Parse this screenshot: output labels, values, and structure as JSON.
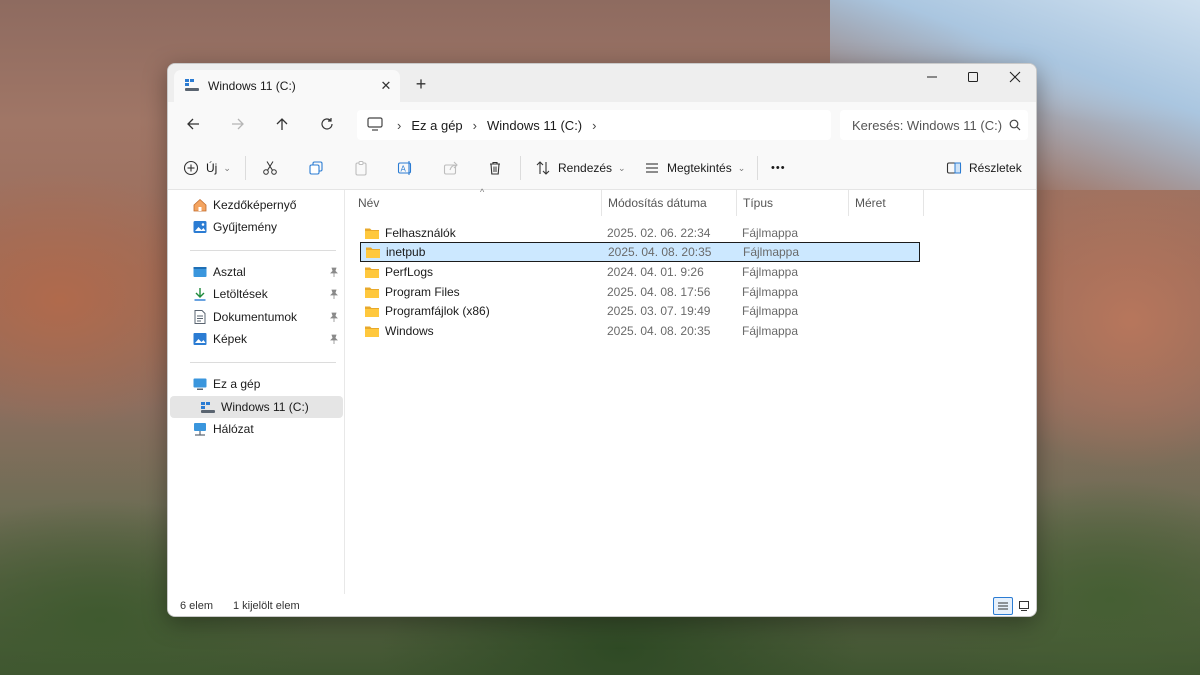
{
  "window": {
    "tab_title": "Windows 11 (C:)",
    "tab_close_icon": "close-icon",
    "new_tab_icon": "plus-icon"
  },
  "nav": {
    "crumbs": [
      "Ez a gép",
      "Windows 11 (C:)"
    ],
    "search_placeholder": "Keresés: Windows 11 (C:)"
  },
  "toolbar": {
    "new_label": "Új",
    "sort_label": "Rendezés",
    "view_label": "Megtekintés",
    "more_label": "•••",
    "details_label": "Részletek"
  },
  "sidebar": {
    "top": [
      "Kezdőképernyő",
      "Gyűjtemény"
    ],
    "pinned": [
      "Asztal",
      "Letöltések",
      "Dokumentumok",
      "Képek"
    ],
    "bottom": [
      "Ez a gép",
      "Windows 11 (C:)",
      "Hálózat"
    ]
  },
  "columns": {
    "name": "Név",
    "date": "Módosítás dátuma",
    "type": "Típus",
    "size": "Méret"
  },
  "files": [
    {
      "name": "Felhasználók",
      "date": "2025. 02. 06. 22:34",
      "type": "Fájlmappa"
    },
    {
      "name": "inetpub",
      "date": "2025. 04. 08. 20:35",
      "type": "Fájlmappa"
    },
    {
      "name": "PerfLogs",
      "date": "2024. 04. 01. 9:26",
      "type": "Fájlmappa"
    },
    {
      "name": "Program Files",
      "date": "2025. 04. 08. 17:56",
      "type": "Fájlmappa"
    },
    {
      "name": "Programfájlok (x86)",
      "date": "2025. 03. 07. 19:49",
      "type": "Fájlmappa"
    },
    {
      "name": "Windows",
      "date": "2025. 04. 08. 20:35",
      "type": "Fájlmappa"
    }
  ],
  "status": {
    "count": "6 elem",
    "selected": "1 kijelölt elem"
  },
  "colors": {
    "accent": "#2b7cd3",
    "selection": "#cce8ff",
    "folder": "#ffc83d"
  }
}
